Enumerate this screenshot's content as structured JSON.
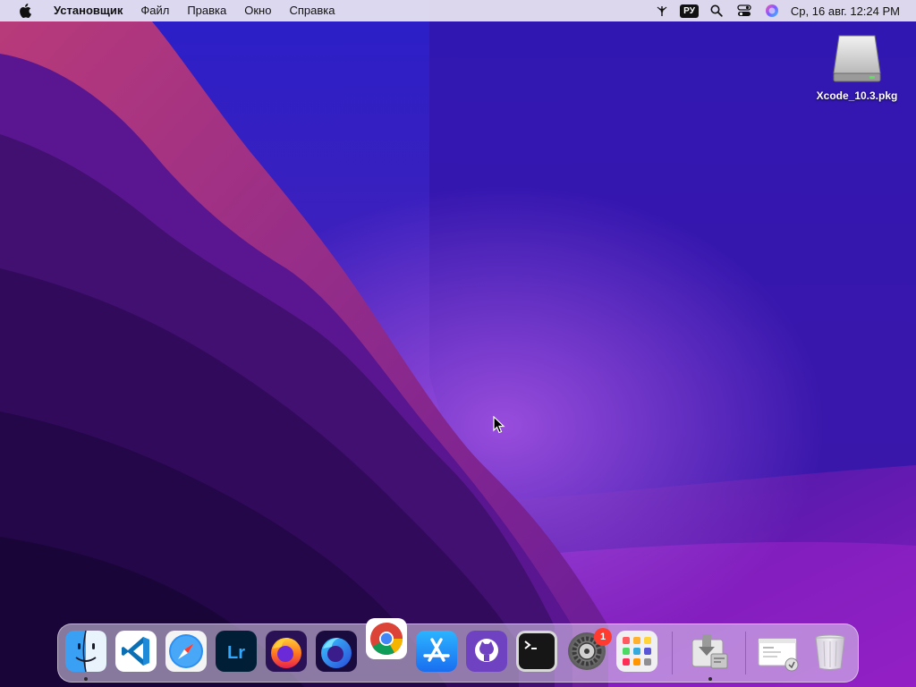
{
  "menubar": {
    "app_name": "Установщик",
    "menus": [
      "Файл",
      "Правка",
      "Окно",
      "Справка"
    ],
    "input_language": "РУ",
    "clock": "Ср, 16 авг.  12:24 PM",
    "icons": [
      "apple-icon",
      "network-icon",
      "search-icon",
      "control-center-icon",
      "siri-icon"
    ]
  },
  "desktop": {
    "file_label": "Xcode_10.3.pkg",
    "file_icon": "disk-image-icon"
  },
  "dock": {
    "apps": [
      "Finder",
      "Visual Studio Code",
      "Safari",
      "Lightroom",
      "Firefox",
      "Firefox Developer Edition",
      "Google Chrome",
      "App Store",
      "GitHub Desktop",
      "Terminal",
      "System Preferences",
      "Launchpad"
    ],
    "system_prefs_badge": "1",
    "lightroom_label": "Lr",
    "extras": [
      "Downloads",
      "Installer document",
      "Trash"
    ]
  },
  "colors": {
    "accent_red": "#ff3b30",
    "wallpaper_deep": "#1a0850",
    "wallpaper_purple": "#7a1cb8"
  }
}
